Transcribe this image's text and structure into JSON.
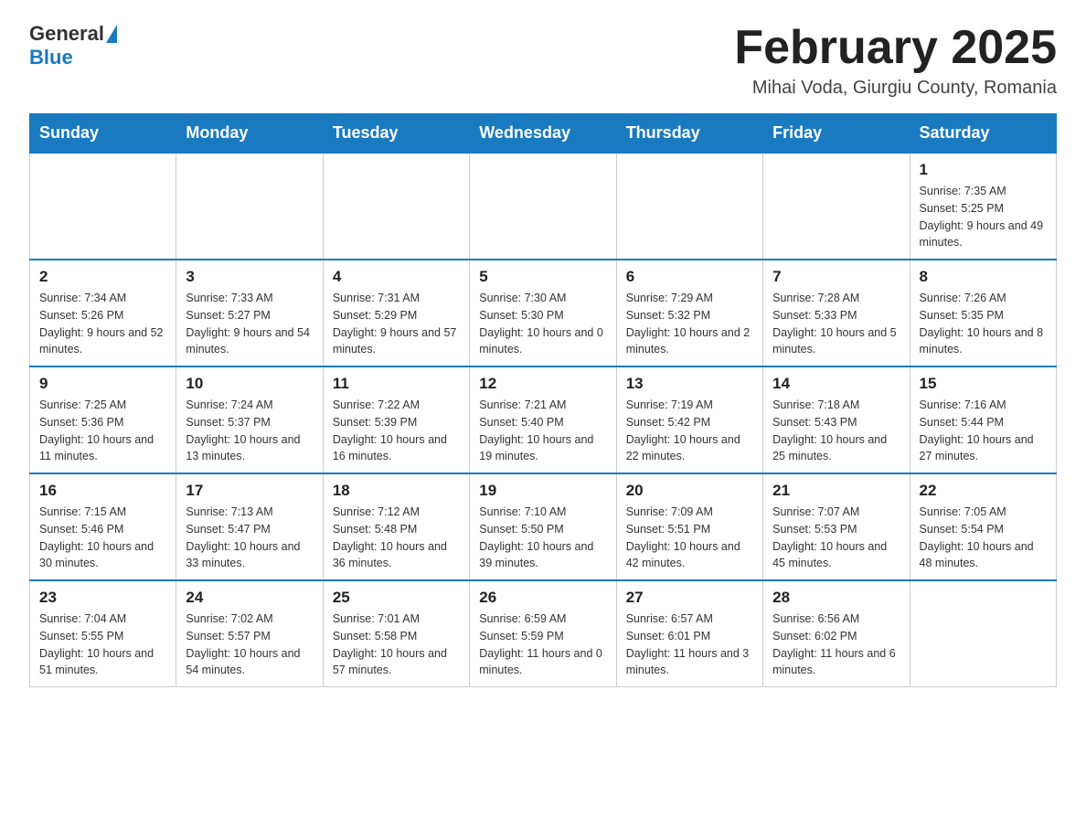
{
  "logo": {
    "general": "General",
    "blue": "Blue"
  },
  "title": "February 2025",
  "location": "Mihai Voda, Giurgiu County, Romania",
  "days_of_week": [
    "Sunday",
    "Monday",
    "Tuesday",
    "Wednesday",
    "Thursday",
    "Friday",
    "Saturday"
  ],
  "weeks": [
    [
      {
        "day": "",
        "info": ""
      },
      {
        "day": "",
        "info": ""
      },
      {
        "day": "",
        "info": ""
      },
      {
        "day": "",
        "info": ""
      },
      {
        "day": "",
        "info": ""
      },
      {
        "day": "",
        "info": ""
      },
      {
        "day": "1",
        "info": "Sunrise: 7:35 AM\nSunset: 5:25 PM\nDaylight: 9 hours and 49 minutes."
      }
    ],
    [
      {
        "day": "2",
        "info": "Sunrise: 7:34 AM\nSunset: 5:26 PM\nDaylight: 9 hours and 52 minutes."
      },
      {
        "day": "3",
        "info": "Sunrise: 7:33 AM\nSunset: 5:27 PM\nDaylight: 9 hours and 54 minutes."
      },
      {
        "day": "4",
        "info": "Sunrise: 7:31 AM\nSunset: 5:29 PM\nDaylight: 9 hours and 57 minutes."
      },
      {
        "day": "5",
        "info": "Sunrise: 7:30 AM\nSunset: 5:30 PM\nDaylight: 10 hours and 0 minutes."
      },
      {
        "day": "6",
        "info": "Sunrise: 7:29 AM\nSunset: 5:32 PM\nDaylight: 10 hours and 2 minutes."
      },
      {
        "day": "7",
        "info": "Sunrise: 7:28 AM\nSunset: 5:33 PM\nDaylight: 10 hours and 5 minutes."
      },
      {
        "day": "8",
        "info": "Sunrise: 7:26 AM\nSunset: 5:35 PM\nDaylight: 10 hours and 8 minutes."
      }
    ],
    [
      {
        "day": "9",
        "info": "Sunrise: 7:25 AM\nSunset: 5:36 PM\nDaylight: 10 hours and 11 minutes."
      },
      {
        "day": "10",
        "info": "Sunrise: 7:24 AM\nSunset: 5:37 PM\nDaylight: 10 hours and 13 minutes."
      },
      {
        "day": "11",
        "info": "Sunrise: 7:22 AM\nSunset: 5:39 PM\nDaylight: 10 hours and 16 minutes."
      },
      {
        "day": "12",
        "info": "Sunrise: 7:21 AM\nSunset: 5:40 PM\nDaylight: 10 hours and 19 minutes."
      },
      {
        "day": "13",
        "info": "Sunrise: 7:19 AM\nSunset: 5:42 PM\nDaylight: 10 hours and 22 minutes."
      },
      {
        "day": "14",
        "info": "Sunrise: 7:18 AM\nSunset: 5:43 PM\nDaylight: 10 hours and 25 minutes."
      },
      {
        "day": "15",
        "info": "Sunrise: 7:16 AM\nSunset: 5:44 PM\nDaylight: 10 hours and 27 minutes."
      }
    ],
    [
      {
        "day": "16",
        "info": "Sunrise: 7:15 AM\nSunset: 5:46 PM\nDaylight: 10 hours and 30 minutes."
      },
      {
        "day": "17",
        "info": "Sunrise: 7:13 AM\nSunset: 5:47 PM\nDaylight: 10 hours and 33 minutes."
      },
      {
        "day": "18",
        "info": "Sunrise: 7:12 AM\nSunset: 5:48 PM\nDaylight: 10 hours and 36 minutes."
      },
      {
        "day": "19",
        "info": "Sunrise: 7:10 AM\nSunset: 5:50 PM\nDaylight: 10 hours and 39 minutes."
      },
      {
        "day": "20",
        "info": "Sunrise: 7:09 AM\nSunset: 5:51 PM\nDaylight: 10 hours and 42 minutes."
      },
      {
        "day": "21",
        "info": "Sunrise: 7:07 AM\nSunset: 5:53 PM\nDaylight: 10 hours and 45 minutes."
      },
      {
        "day": "22",
        "info": "Sunrise: 7:05 AM\nSunset: 5:54 PM\nDaylight: 10 hours and 48 minutes."
      }
    ],
    [
      {
        "day": "23",
        "info": "Sunrise: 7:04 AM\nSunset: 5:55 PM\nDaylight: 10 hours and 51 minutes."
      },
      {
        "day": "24",
        "info": "Sunrise: 7:02 AM\nSunset: 5:57 PM\nDaylight: 10 hours and 54 minutes."
      },
      {
        "day": "25",
        "info": "Sunrise: 7:01 AM\nSunset: 5:58 PM\nDaylight: 10 hours and 57 minutes."
      },
      {
        "day": "26",
        "info": "Sunrise: 6:59 AM\nSunset: 5:59 PM\nDaylight: 11 hours and 0 minutes."
      },
      {
        "day": "27",
        "info": "Sunrise: 6:57 AM\nSunset: 6:01 PM\nDaylight: 11 hours and 3 minutes."
      },
      {
        "day": "28",
        "info": "Sunrise: 6:56 AM\nSunset: 6:02 PM\nDaylight: 11 hours and 6 minutes."
      },
      {
        "day": "",
        "info": ""
      }
    ]
  ]
}
